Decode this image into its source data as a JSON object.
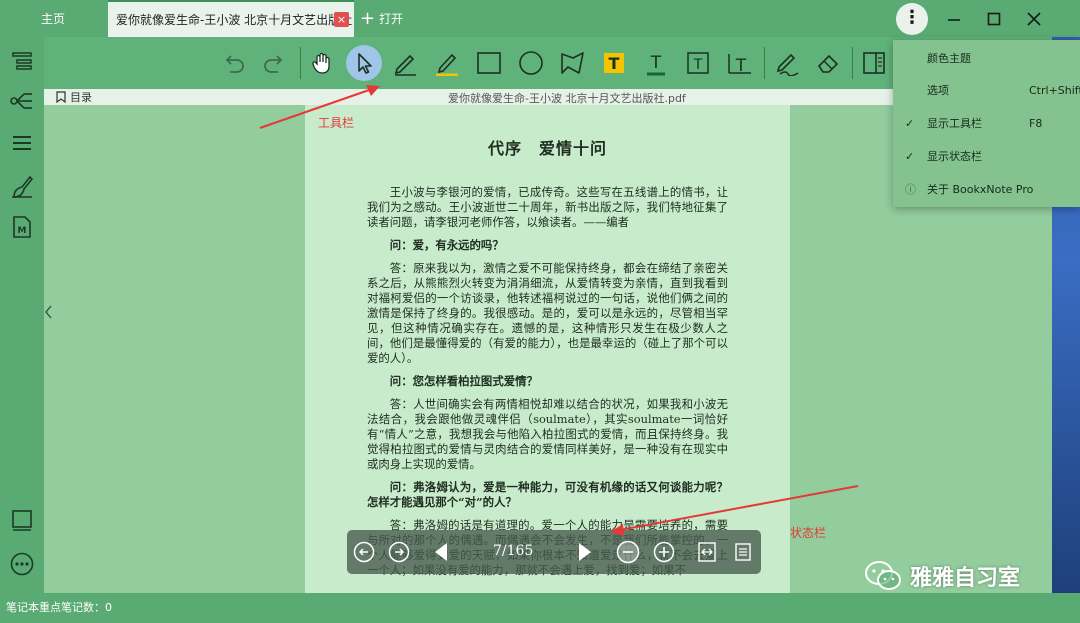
{
  "tabs": {
    "home": "主页",
    "document": "爱你就像爱生命-王小波 北京十月文艺出版社",
    "close_symbol": "×",
    "new_tab_symbol": "+",
    "new_tab_label": "打开"
  },
  "window": {
    "menu_symbol": "⋮",
    "minimize_symbol": "—",
    "maximize_symbol": "☐",
    "close_symbol": "✕"
  },
  "left_icons": [
    "outline-list-icon",
    "mindmap-icon",
    "stack-list-icon",
    "pen-note-icon",
    "markdown-file-icon",
    "book-icon",
    "more-circle-icon"
  ],
  "toolbar": {
    "tools": [
      "undo-icon",
      "redo-icon",
      "hand-icon",
      "select-arrow-icon",
      "pen-icon",
      "highlighter-icon",
      "rectangle-icon",
      "ellipse-icon",
      "polygon-icon",
      "text-highlight-icon",
      "text-underline-icon",
      "text-box-icon",
      "text-strike-icon",
      "freehand-pen-icon",
      "eraser-icon",
      "layout-icon"
    ],
    "active_tool": "select-arrow-icon",
    "highlight_color": "#f5c400",
    "underline_color": "#0d6b3a"
  },
  "infobar": {
    "toc_label": "目录",
    "pdf_title": "爱你就像爱生命-王小波 北京十月文艺出版社.pdf"
  },
  "page": {
    "title": "代序　爱情十问",
    "paragraphs": [
      {
        "type": "text",
        "text": "王小波与李银河的爱情，已成传奇。这些写在五线谱上的情书，让我们为之感动。王小波逝世二十周年，新书出版之际，我们特地征集了读者问题，请李银河老师作答，以飨读者。——编者"
      },
      {
        "type": "q",
        "text": "问：爱，有永远的吗？"
      },
      {
        "type": "text",
        "text": "答：原来我以为，激情之爱不可能保持终身，都会在缔结了亲密关系之后，从熊熊烈火转变为涓涓细流，从爱情转变为亲情，直到我看到对福柯爱侣的一个访谈录，他转述福柯说过的一句话，说他们俩之间的激情是保持了终身的。我很感动。是的，爱可以是永远的，尽管相当罕见，但这种情况确实存在。遗憾的是，这种情形只发生在极少数人之间，他们是最懂得爱的（有爱的能力），也是最幸运的（碰上了那个可以爱的人）。"
      },
      {
        "type": "q",
        "text": "问：您怎样看柏拉图式爱情？"
      },
      {
        "type": "text",
        "text": "答：人世间确实会有两情相悦却难以结合的状况，如果我和小波无法结合，我会跟他做灵魂伴侣（soulmate），其实soulmate一词恰好有“情人”之意，我想我会与他陷入柏拉图式的爱情，而且保持终身。我觉得柏拉图式的爱情与灵肉结合的爱情同样美好，是一种没有在现实中或肉身上实现的爱情。"
      },
      {
        "type": "q",
        "text": "问：弗洛姆认为，爱是一种能力，可没有机缘的话又何谈能力呢？怎样才能遇见那个“对”的人？"
      },
      {
        "type": "text",
        "text": "答：弗洛姆的话是有道理的。爱一个人的能力是需要培养的，需要与所对的那个人的偶遇。而偶遇会不会发生，不是我们所能掌控的。一个人能够爱得到爱的天赋，如果你根本不知道爱是什么，就不会去爱上一个人；如果没有爱的能力，那就不会遇上爱，找到爱；如果不"
      }
    ]
  },
  "nav": {
    "page_indicator": "7/165",
    "buttons": [
      "back-icon",
      "forward-icon",
      "prev-page-icon",
      "next-page-icon",
      "zoom-out-icon",
      "zoom-in-icon",
      "fit-page-icon",
      "page-list-icon"
    ]
  },
  "menu": {
    "items": [
      {
        "label": "颜色主题",
        "shortcut": "",
        "checked": false
      },
      {
        "label": "选项",
        "shortcut": "Ctrl+Shift+",
        "checked": false
      },
      {
        "label": "显示工具栏",
        "shortcut": "F8",
        "checked": true
      },
      {
        "label": "显示状态栏",
        "shortcut": "",
        "checked": true
      },
      {
        "label": "关于 BookxNote Pro",
        "shortcut": "",
        "checked": false,
        "icon": "info-icon"
      }
    ],
    "check_symbol": "✓",
    "info_symbol": "ⓘ"
  },
  "status": {
    "text": "笔记本重点笔记数：0"
  },
  "annotations": {
    "toolbar_label": "工具栏",
    "statusbar_label": "状态栏"
  },
  "watermark": {
    "text": "雅雅自习室"
  }
}
